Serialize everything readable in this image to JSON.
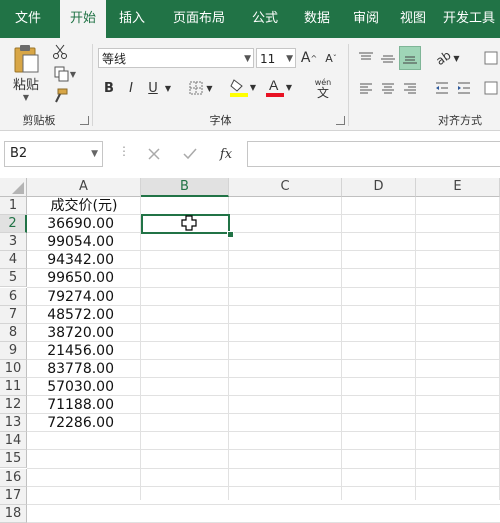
{
  "ribbon_tabs": [
    "文件",
    "开始",
    "插入",
    "页面布局",
    "公式",
    "数据",
    "审阅",
    "视图",
    "开发工具"
  ],
  "active_tab": "开始",
  "clipboard": {
    "paste_label": "粘贴",
    "group_label": "剪贴板"
  },
  "font": {
    "name": "等线",
    "size": "11",
    "group_label": "字体",
    "bold": "B",
    "italic": "I",
    "underline": "U",
    "phonetic": "wén"
  },
  "alignment": {
    "group_label": "对齐方式"
  },
  "formula_bar": {
    "name_box": "B2",
    "fx": "fx",
    "content": ""
  },
  "columns": [
    "A",
    "B",
    "C",
    "D",
    "E"
  ],
  "selected_cell": "B2",
  "rows": [
    "1",
    "2",
    "3",
    "4",
    "5",
    "6",
    "7",
    "8",
    "9",
    "10",
    "11",
    "12",
    "13",
    "14",
    "15",
    "16",
    "17",
    "18"
  ],
  "sheet": {
    "header": "成交价(元)",
    "values": [
      "36690.00",
      "99054.00",
      "94342.00",
      "99650.00",
      "79274.00",
      "48572.00",
      "38720.00",
      "21456.00",
      "83778.00",
      "57030.00",
      "71188.00",
      "72286.00"
    ]
  },
  "colors": {
    "excel_green": "#217346",
    "font_color_bar": "#e81123",
    "highlight_bar": "#ffff00",
    "selected_align": "#9fd5b7"
  }
}
